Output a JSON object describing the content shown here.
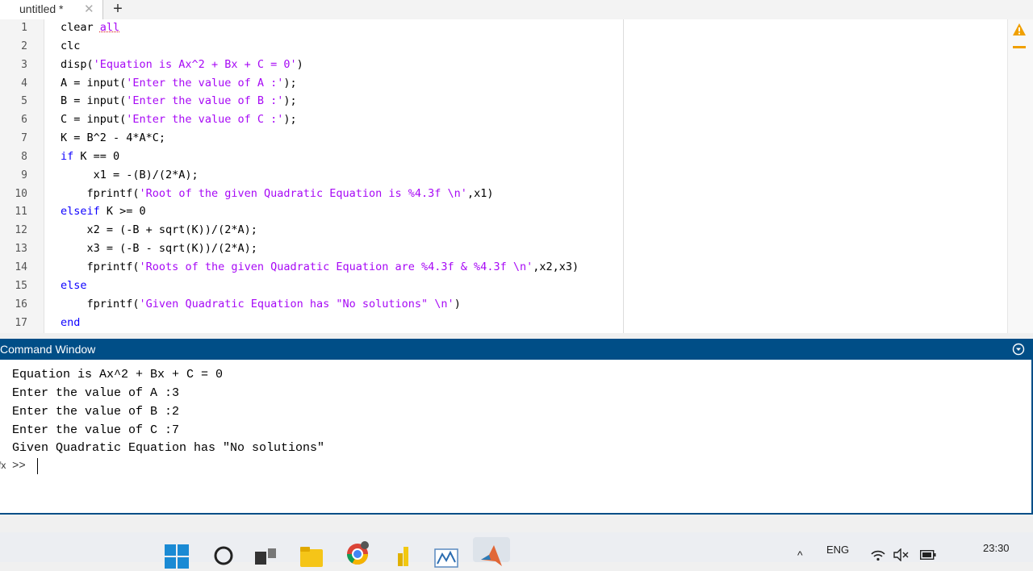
{
  "tab": {
    "title": "untitled *",
    "close": "✕",
    "add": "+"
  },
  "editor": {
    "line_numbers": [
      "1",
      "2",
      "3",
      "4",
      "5",
      "6",
      "7",
      "8",
      "9",
      "10",
      "11",
      "12",
      "13",
      "14",
      "15",
      "16",
      "17"
    ]
  },
  "code": {
    "l1_a": "clear ",
    "l1_b": "all",
    "l2": "clc",
    "l3_a": "disp(",
    "l3_b": "'Equation is Ax^2 + Bx + C = 0'",
    "l3_c": ")",
    "l4_a": "A = input(",
    "l4_b": "'Enter the value of A :'",
    "l4_c": ");",
    "l5_a": "B = input(",
    "l5_b": "'Enter the value of B :'",
    "l5_c": ");",
    "l6_a": "C = input(",
    "l6_b": "'Enter the value of C :'",
    "l6_c": ");",
    "l7": "K = B^2 - 4*A*C;",
    "l8_a": "if",
    "l8_b": " K == 0",
    "l9": "     x1 = -(B)/(2*A);",
    "l10_a": "    fprintf(",
    "l10_b": "'Root of the given Quadratic Equation is %4.3f \\n'",
    "l10_c": ",x1)",
    "l11_a": "elseif",
    "l11_b": " K >= 0",
    "l12": "    x2 = (-B + sqrt(K))/(2*A);",
    "l13": "    x3 = (-B - sqrt(K))/(2*A);",
    "l14_a": "    fprintf(",
    "l14_b": "'Roots of the given Quadratic Equation are %4.3f & %4.3f \\n'",
    "l14_c": ",x2,x3)",
    "l15": "else",
    "l16_a": "    fprintf(",
    "l16_b": "'Given Quadratic Equation has \"No solutions\" \\n'",
    "l16_c": ")",
    "l17": "end"
  },
  "command_window": {
    "title": "Command Window",
    "lines": [
      "Equation is Ax^2 + Bx + C = 0",
      "Enter the value of A :3",
      "Enter the value of B :2",
      "Enter the value of C :7",
      "Given Quadratic Equation has \"No solutions\""
    ],
    "prompt": ">>",
    "fx": "fx"
  },
  "taskbar": {
    "language": "ENG",
    "time": "23:30",
    "chevron": "^"
  },
  "colors": {
    "keyword": "#0e00ff",
    "string": "#a709f5",
    "command_header": "#004e87",
    "warning": "#f0a000"
  }
}
